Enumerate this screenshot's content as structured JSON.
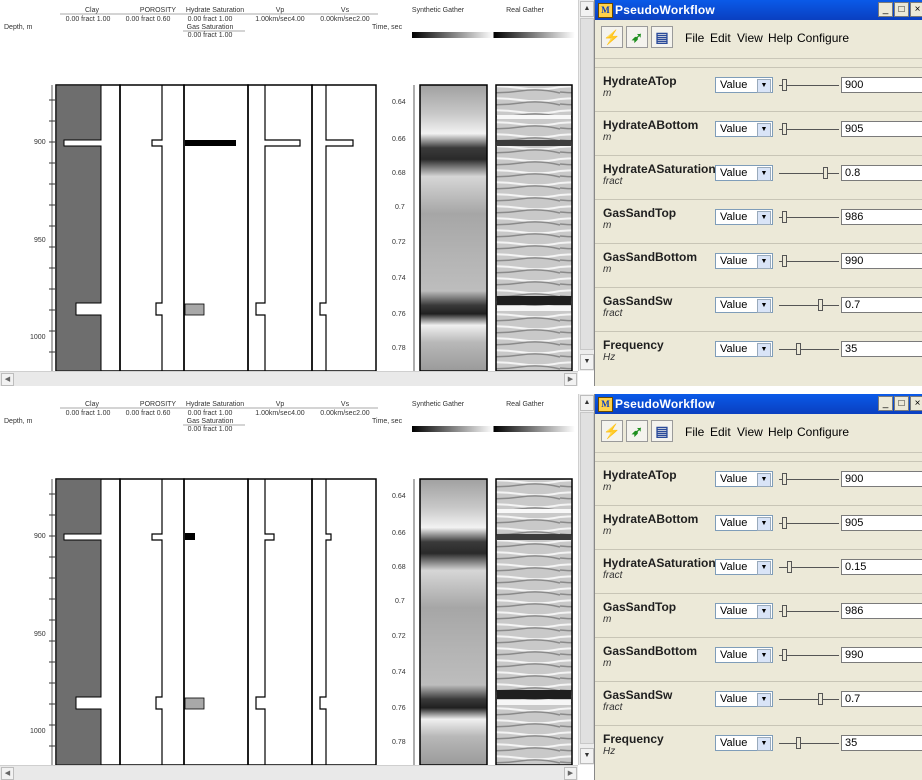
{
  "panels": [
    {
      "log_headers": {
        "depth_label": "Depth, m",
        "tracks": [
          {
            "name": "Clay",
            "range": "0.00 fract 1.00"
          },
          {
            "name": "POROSITY",
            "range": "0.00 fract 0.60"
          },
          {
            "name": "Hydrate Saturation",
            "range": "0.00 fract 1.00",
            "name2": "Gas Saturation",
            "range2": "0.00 fract 1.00"
          },
          {
            "name": "Vp",
            "range": "1.00km/sec4.00"
          },
          {
            "name": "Vs",
            "range": "0.00km/sec2.00"
          }
        ],
        "time_label": "Time, sec",
        "gathers": [
          "Synthetic Gather",
          "Real Gather"
        ]
      },
      "depth_ticks": [
        "900",
        "950",
        "1000"
      ],
      "time_ticks": [
        "0.64",
        "0.66",
        "0.68",
        "0.7",
        "0.72",
        "0.74",
        "0.76",
        "0.78"
      ],
      "window": {
        "title": "PseudoWorkflow",
        "buttons": [
          "_",
          "□",
          "×"
        ],
        "menu": [
          "File",
          "Edit",
          "View",
          "Help",
          "Configure"
        ],
        "params": [
          {
            "name": "HydrateATop",
            "unit": "m",
            "mode": "Value",
            "value": "900",
            "slider": 0.05
          },
          {
            "name": "HydrateABottom",
            "unit": "m",
            "mode": "Value",
            "value": "905",
            "slider": 0.05
          },
          {
            "name": "HydrateASaturation",
            "unit": "fract",
            "mode": "Value",
            "value": "0.8",
            "slider": 0.8
          },
          {
            "name": "GasSandTop",
            "unit": "m",
            "mode": "Value",
            "value": "986",
            "slider": 0.05
          },
          {
            "name": "GasSandBottom",
            "unit": "m",
            "mode": "Value",
            "value": "990",
            "slider": 0.05
          },
          {
            "name": "GasSandSw",
            "unit": "fract",
            "mode": "Value",
            "value": "0.7",
            "slider": 0.7
          },
          {
            "name": "Frequency",
            "unit": "Hz",
            "mode": "Value",
            "value": "35",
            "slider": 0.3
          }
        ]
      }
    },
    {
      "log_headers": {
        "depth_label": "Depth, m",
        "tracks": [
          {
            "name": "Clay",
            "range": "0.00 fract 1.00"
          },
          {
            "name": "POROSITY",
            "range": "0.00 fract 0.60"
          },
          {
            "name": "Hydrate Saturation",
            "range": "0.00 fract 1.00",
            "name2": "Gas Saturation",
            "range2": "0.00 fract 1.00"
          },
          {
            "name": "Vp",
            "range": "1.00km/sec4.00"
          },
          {
            "name": "Vs",
            "range": "0.00km/sec2.00"
          }
        ],
        "time_label": "Time, sec",
        "gathers": [
          "Synthetic Gather",
          "Real Gather"
        ]
      },
      "depth_ticks": [
        "900",
        "950",
        "1000"
      ],
      "time_ticks": [
        "0.64",
        "0.66",
        "0.68",
        "0.7",
        "0.72",
        "0.74",
        "0.76",
        "0.78"
      ],
      "window": {
        "title": "PseudoWorkflow",
        "buttons": [
          "_",
          "□",
          "×"
        ],
        "menu": [
          "File",
          "Edit",
          "View",
          "Help",
          "Configure"
        ],
        "params": [
          {
            "name": "HydrateATop",
            "unit": "m",
            "mode": "Value",
            "value": "900",
            "slider": 0.05
          },
          {
            "name": "HydrateABottom",
            "unit": "m",
            "mode": "Value",
            "value": "905",
            "slider": 0.05
          },
          {
            "name": "HydrateASaturation",
            "unit": "fract",
            "mode": "Value",
            "value": "0.15",
            "slider": 0.15
          },
          {
            "name": "GasSandTop",
            "unit": "m",
            "mode": "Value",
            "value": "986",
            "slider": 0.05
          },
          {
            "name": "GasSandBottom",
            "unit": "m",
            "mode": "Value",
            "value": "990",
            "slider": 0.05
          },
          {
            "name": "GasSandSw",
            "unit": "fract",
            "mode": "Value",
            "value": "0.7",
            "slider": 0.7
          },
          {
            "name": "Frequency",
            "unit": "Hz",
            "mode": "Value",
            "value": "35",
            "slider": 0.3
          }
        ]
      }
    }
  ],
  "colors": {
    "clay_fill": "#6e6e6e",
    "hydrate_fill": "#000000",
    "gas_fill": "#a8a8a8",
    "titlebar": "#0a4fd4",
    "window_bg": "#ece9d8"
  }
}
